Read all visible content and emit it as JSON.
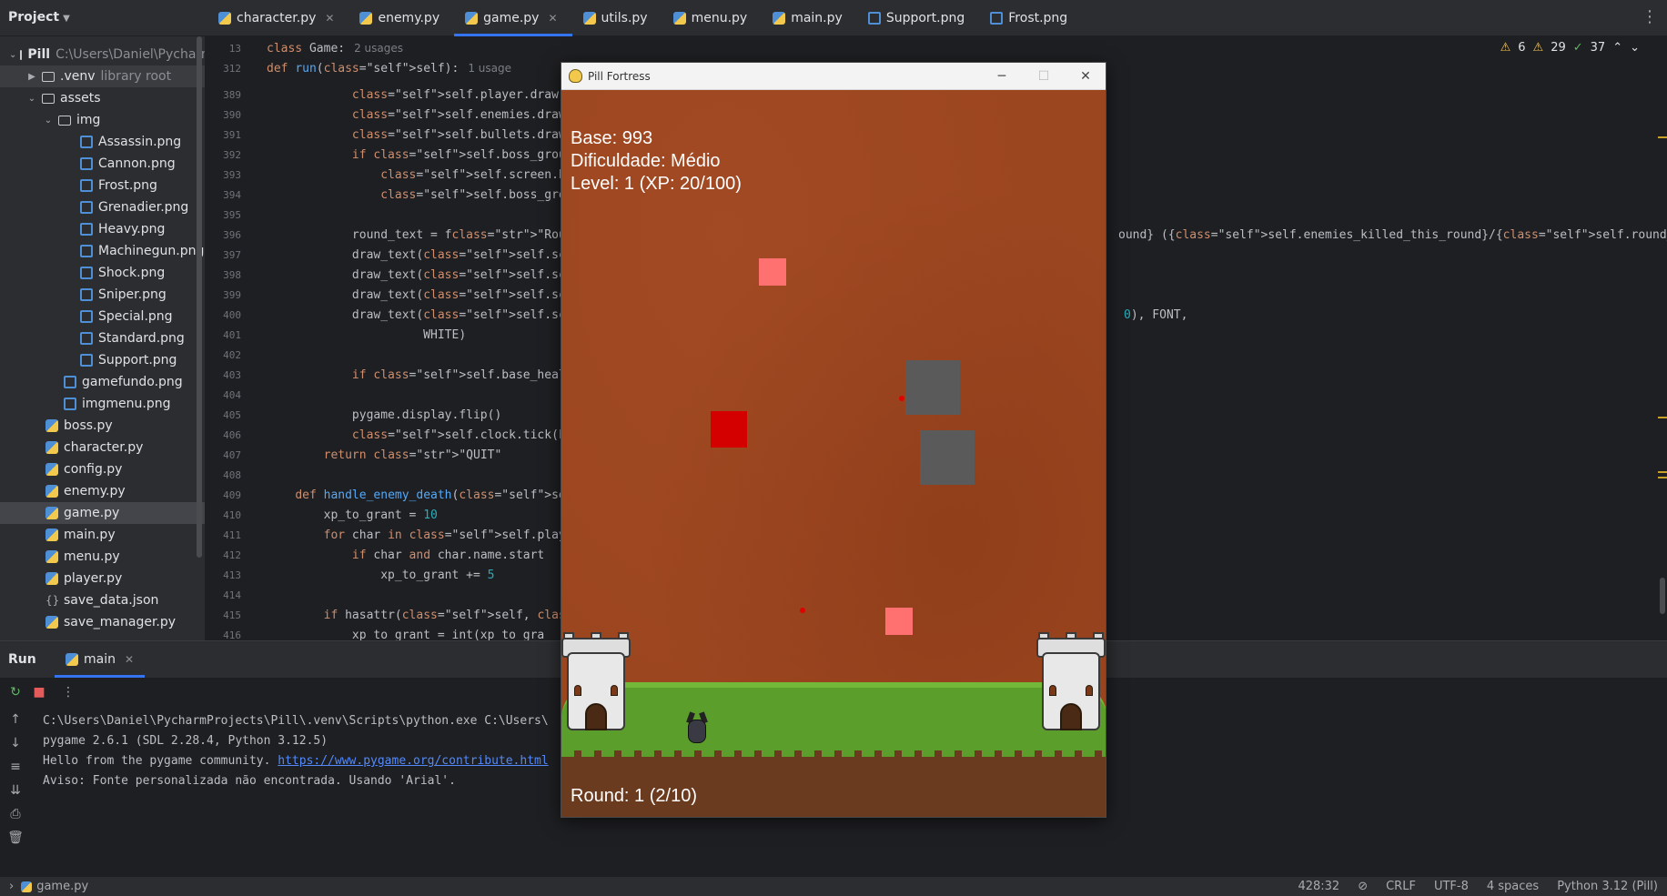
{
  "topbar": {
    "project_label": "Project",
    "tabs": [
      {
        "label": "character.py",
        "type": "py",
        "closable": true
      },
      {
        "label": "enemy.py",
        "type": "py"
      },
      {
        "label": "game.py",
        "type": "py",
        "active": true,
        "closable": true
      },
      {
        "label": "utils.py",
        "type": "py"
      },
      {
        "label": "menu.py",
        "type": "py"
      },
      {
        "label": "main.py",
        "type": "py"
      },
      {
        "label": "Support.png",
        "type": "png"
      },
      {
        "label": "Frost.png",
        "type": "png"
      }
    ]
  },
  "tree": {
    "root_name": "Pill",
    "root_path": "C:\\Users\\Daniel\\PycharmProjects\\Pill",
    "venv": ".venv",
    "venv_note": "library root",
    "assets": "assets",
    "img": "img",
    "img_files": [
      "Assassin.png",
      "Cannon.png",
      "Frost.png",
      "Grenadier.png",
      "Heavy.png",
      "Machinegun.png",
      "Shock.png",
      "Sniper.png",
      "Special.png",
      "Standard.png",
      "Support.png"
    ],
    "asset_files": [
      "gamefundo.png",
      "imgmenu.png"
    ],
    "py_files": [
      "boss.py",
      "character.py",
      "config.py",
      "enemy.py",
      "game.py",
      "main.py",
      "menu.py",
      "player.py",
      "save_data.json",
      "save_manager.py"
    ],
    "selected": "game.py"
  },
  "editor": {
    "sticky1": {
      "ln": "13",
      "code": "class Game:",
      "hint": "2 usages"
    },
    "sticky2": {
      "ln": "312",
      "code": "def run(self):",
      "hint": "1 usage"
    },
    "inspections": {
      "warnings": "6",
      "weak": "29",
      "ok": "37"
    },
    "lines": [
      {
        "ln": "389",
        "text": "            self.player.draw(self.scree"
      },
      {
        "ln": "390",
        "text": "            self.enemies.draw(self.scre"
      },
      {
        "ln": "391",
        "text": "            self.bullets.draw(self.scre"
      },
      {
        "ln": "392",
        "text": "            if self.boss_group.sprite:"
      },
      {
        "ln": "393",
        "text": "                self.screen.blit(self.b"
      },
      {
        "ln": "394",
        "text": "                self.boss_group.sprite."
      },
      {
        "ln": "395",
        "text": ""
      },
      {
        "ln": "396",
        "text": "            round_text = f\"Round: {self",
        "tail": "ound} ({self.enemies_killed_this_round}/{self.round_goal})\""
      },
      {
        "ln": "397",
        "text": "            draw_text(self.screen, roun"
      },
      {
        "ln": "398",
        "text": "            draw_text(self.screen,  text:"
      },
      {
        "ln": "399",
        "text": "            draw_text(self.screen,  text:"
      },
      {
        "ln": "400",
        "text": "            draw_text(self.screen,  text:",
        "tail": "0), FONT,"
      },
      {
        "ln": "401",
        "text": "                      WHITE)"
      },
      {
        "ln": "402",
        "text": ""
      },
      {
        "ln": "403",
        "text": "            if self.base_health <= 0: r"
      },
      {
        "ln": "404",
        "text": ""
      },
      {
        "ln": "405",
        "text": "            pygame.display.flip()"
      },
      {
        "ln": "406",
        "text": "            self.clock.tick(FPS)"
      },
      {
        "ln": "407",
        "text": "        return \"QUIT\""
      },
      {
        "ln": "408",
        "text": ""
      },
      {
        "ln": "409",
        "text": "    def handle_enemy_death(self, enemy)"
      },
      {
        "ln": "410",
        "text": "        xp_to_grant = 10"
      },
      {
        "ln": "411",
        "text": "        for char in self.player.slots:"
      },
      {
        "ln": "412",
        "text": "            if char and char.name.start"
      },
      {
        "ln": "413",
        "text": "                xp_to_grant += 5"
      },
      {
        "ln": "414",
        "text": ""
      },
      {
        "ln": "415",
        "text": "        if hasattr(self, 'xp_multiplier"
      },
      {
        "ln": "416",
        "text": "            xp_to_grant = int(xp_to_gra"
      }
    ]
  },
  "run": {
    "title": "Run",
    "tab": "main",
    "console": [
      "C:\\Users\\Daniel\\PycharmProjects\\Pill\\.venv\\Scripts\\python.exe C:\\Users\\",
      "pygame 2.6.1 (SDL 2.28.4, Python 3.12.5)",
      "Hello from the pygame community. ",
      "Aviso: Fonte personalizada não encontrada. Usando 'Arial'."
    ],
    "link": "https://www.pygame.org/contribute.html"
  },
  "game": {
    "window_title": "Pill Fortress",
    "base": "Base: 993",
    "difficulty": "Dificuldade: Médio",
    "level": "Level: 1 (XP: 20/100)",
    "round": "Round: 1 (2/10)"
  },
  "status": {
    "file": "game.py",
    "position": "428:32",
    "line_sep": "CRLF",
    "encoding": "UTF-8",
    "indent": "4 spaces",
    "interpreter": "Python 3.12 (Pill)"
  },
  "colors": {
    "accent": "#3574f0",
    "ground": "#9c4620",
    "enemy_light": "#ff7070",
    "enemy_red": "#d40000",
    "enemy_gray": "#5a5a5a"
  }
}
